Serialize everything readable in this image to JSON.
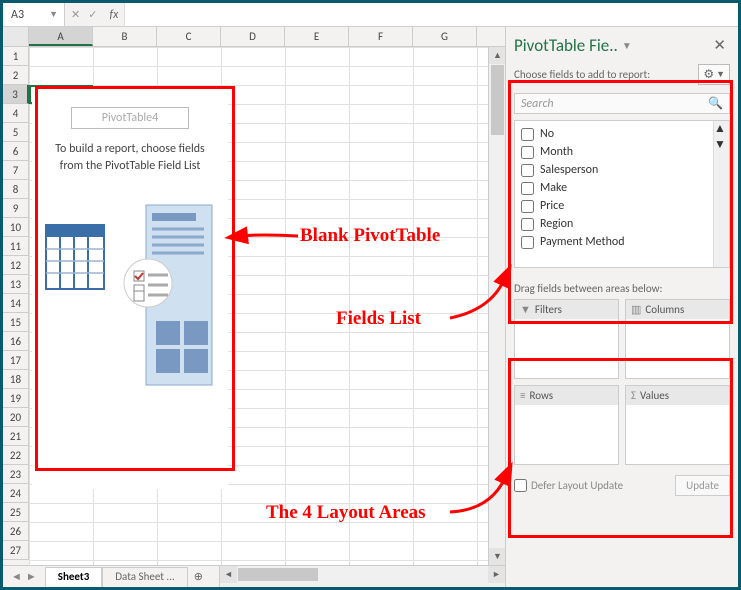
{
  "formula_bar": {
    "cell_ref": "A3",
    "fx_label": "fx"
  },
  "columns": [
    "A",
    "B",
    "C",
    "D",
    "E",
    "F",
    "G"
  ],
  "rows_count": 27,
  "active_row": 3,
  "active_col": "A",
  "pivot_placeholder": {
    "name": "PivotTable4",
    "build_line1": "To build a report, choose fields",
    "build_line2": "from the PivotTable Field List"
  },
  "sheet_tabs": {
    "active": "Sheet3",
    "inactive": "Data Sheet  ..."
  },
  "pane": {
    "title": "PivotTable Fie..",
    "choose_label": "Choose fields to add to report:",
    "search_placeholder": "Search",
    "fields": [
      "No",
      "Month",
      "Salesperson",
      "Make",
      "Price",
      "Region",
      "Payment Method"
    ],
    "drag_label": "Drag fields between areas below:",
    "areas": {
      "filters": "Filters",
      "columns": "Columns",
      "rows": "Rows",
      "values": "Values"
    },
    "defer_label": "Defer Layout Update",
    "update_label": "Update"
  },
  "annotations": {
    "blank": "Blank PivotTable",
    "fields": "Fields List",
    "layout": "The 4 Layout Areas"
  }
}
